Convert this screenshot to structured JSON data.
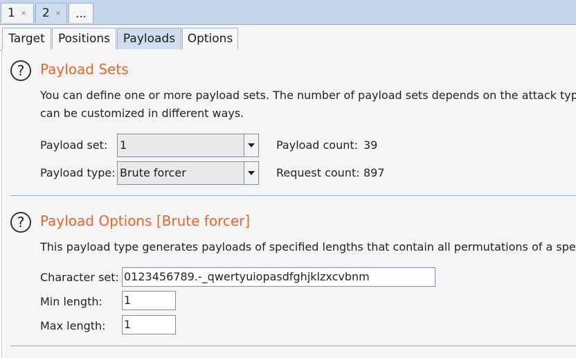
{
  "attack_tabs": [
    {
      "label": "1",
      "close": "×"
    },
    {
      "label": "2",
      "close": "×"
    },
    {
      "label": "..."
    }
  ],
  "sub_tabs": [
    "Target",
    "Positions",
    "Payloads",
    "Options"
  ],
  "active_sub_tab": "Payloads",
  "payload_sets": {
    "help": "?",
    "title": "Payload Sets",
    "description_line1": "You can define one or more payload sets. The number of payload sets depends on the attack type",
    "description_line2": "can be customized in different ways.",
    "payload_set_label": "Payload set:",
    "payload_set_value": "1",
    "payload_type_label": "Payload type:",
    "payload_type_value": "Brute forcer",
    "payload_count_label": "Payload count:",
    "payload_count_value": "39",
    "request_count_label": "Request count:",
    "request_count_value": "897"
  },
  "payload_options": {
    "help": "?",
    "title": "Payload Options [Brute forcer]",
    "description": "This payload type generates payloads of specified lengths that contain all permutations of a speci",
    "charset_label": "Character set:",
    "charset_value": "0123456789.-_qwertyuiopasdfghjklzxcvbnm",
    "min_length_label": "Min length:",
    "min_length_value": "1",
    "max_length_label": "Max length:",
    "max_length_value": "1"
  },
  "colors": {
    "section_title": "#e8652a",
    "tab_bar": "#c3d6ec",
    "active_tab": "#cfdeee"
  }
}
